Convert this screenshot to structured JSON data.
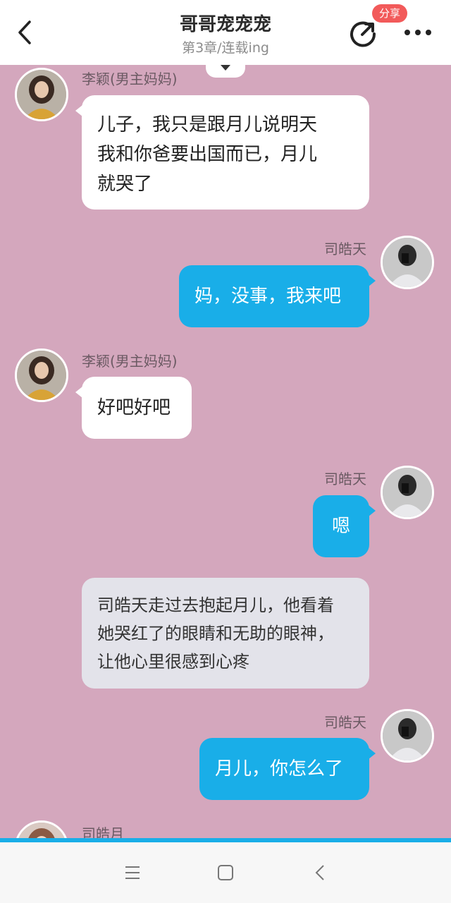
{
  "header": {
    "title": "哥哥宠宠宠",
    "subtitle": "第3章/连载ing",
    "share_badge": "分享"
  },
  "colors": {
    "background": "#d4a7bd",
    "right_bubble": "#19aee8",
    "left_bubble": "#ffffff",
    "narration_bubble": "#e3e3ea",
    "badge": "#f25a5a"
  },
  "messages": [
    {
      "speaker": "李颖(男主妈妈)",
      "side": "left",
      "lines": [
        "儿子，我只是跟月儿说明天",
        "我和你爸要出国而已，月儿",
        "就哭了"
      ]
    },
    {
      "speaker": "司皓天",
      "side": "right",
      "lines": [
        "妈，没事，我来吧"
      ]
    },
    {
      "speaker": "李颖(男主妈妈)",
      "side": "left",
      "lines": [
        "好吧好吧"
      ]
    },
    {
      "speaker": "司皓天",
      "side": "right",
      "lines": [
        "嗯"
      ]
    },
    {
      "speaker": "",
      "side": "narration",
      "lines": [
        "司皓天走过去抱起月儿，他看着",
        "她哭红了的眼睛和无助的眼神，",
        "让他心里很感到心疼"
      ]
    },
    {
      "speaker": "司皓天",
      "side": "right",
      "lines": [
        "月儿，你怎么了"
      ]
    },
    {
      "speaker": "司皓月",
      "side": "left",
      "lines": []
    }
  ],
  "icons": {
    "back": "back-arrow-icon",
    "share": "share-icon",
    "more": "more-dots-icon",
    "collapse": "chevron-down-icon",
    "nav_menu": "menu-icon",
    "nav_home": "home-square-icon",
    "nav_back": "back-chevron-icon"
  }
}
